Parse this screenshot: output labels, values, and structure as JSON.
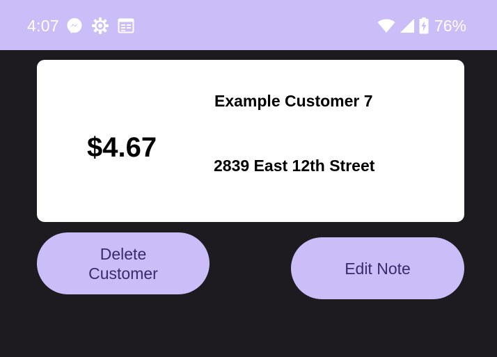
{
  "status_bar": {
    "time": "4:07",
    "left_icons": [
      "messenger-icon",
      "gear-icon",
      "calendar-icon"
    ],
    "right_icons": [
      "wifi-icon",
      "signal-icon",
      "battery-charging-icon"
    ],
    "battery_percent": "76%",
    "background_color": "#cbbdf7"
  },
  "card": {
    "amount": "$4.67",
    "customer_name": "Example Customer 7",
    "address": "2839 East 12th Street"
  },
  "actions": {
    "delete_line1": "Delete",
    "delete_line2": "Customer",
    "edit_label": "Edit Note",
    "button_color": "#cbbdf7",
    "button_text_color": "#3a2a6e"
  },
  "colors": {
    "background": "#1d1b20",
    "card": "#ffffff"
  }
}
